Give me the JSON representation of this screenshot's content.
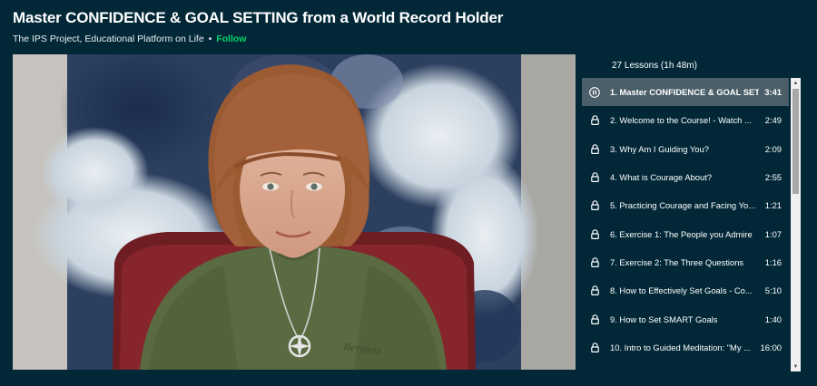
{
  "course": {
    "title": "Master CONFIDENCE & GOAL SETTING from a World Record Holder",
    "author": "The IPS Project, Educational Platform on Life",
    "separator": "•",
    "follow_label": "Follow"
  },
  "video": {
    "shirt_logo_text": "Bergans"
  },
  "playlist": {
    "header": "27 Lessons (1h 48m)",
    "lessons": [
      {
        "title": "1. Master CONFIDENCE & GOAL SET...",
        "duration": "3:41",
        "active": true,
        "icon": "pause-icon"
      },
      {
        "title": "2. Welcome to the Course! - Watch ...",
        "duration": "2:49",
        "icon": "lock-icon"
      },
      {
        "title": "3. Why Am I Guiding You?",
        "duration": "2:09",
        "icon": "lock-icon"
      },
      {
        "title": "4. What is Courage About?",
        "duration": "2:55",
        "icon": "lock-icon"
      },
      {
        "title": "5. Practicing Courage and Facing Yo...",
        "duration": "1:21",
        "icon": "lock-icon"
      },
      {
        "title": "6. Exercise 1: The People you Admire",
        "duration": "1:07",
        "icon": "lock-icon"
      },
      {
        "title": "7. Exercise 2: The Three Questions",
        "duration": "1:16",
        "icon": "lock-icon"
      },
      {
        "title": "8. How to Effectively Set Goals - Co...",
        "duration": "5:10",
        "icon": "lock-icon"
      },
      {
        "title": "9. How to Set SMART Goals",
        "duration": "1:40",
        "icon": "lock-icon"
      },
      {
        "title": "10. Intro to Guided Meditation: \"My ...",
        "duration": "16:00",
        "icon": "lock-icon"
      }
    ]
  },
  "colors": {
    "background": "#022838",
    "follow": "#00d26a",
    "active_row": "#4a5f69"
  }
}
